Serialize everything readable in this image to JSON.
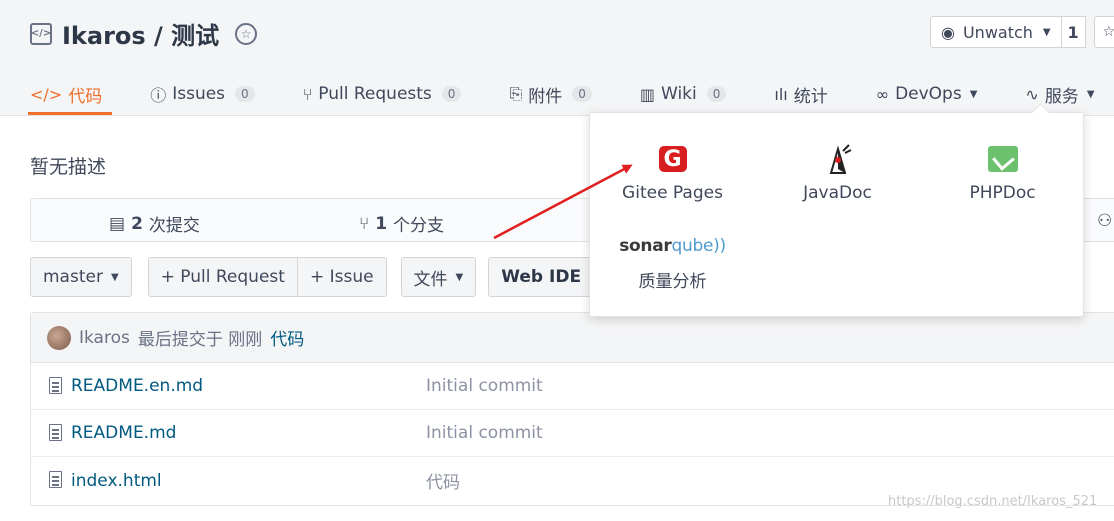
{
  "repo": {
    "title": "Ikaros / 测试"
  },
  "watch": {
    "label": "Unwatch",
    "count": "1"
  },
  "tabs": [
    {
      "label": "代码",
      "count": ""
    },
    {
      "label": "Issues",
      "count": "0"
    },
    {
      "label": "Pull Requests",
      "count": "0"
    },
    {
      "label": "附件",
      "count": "0"
    },
    {
      "label": "Wiki",
      "count": "0"
    },
    {
      "label": "统计",
      "count": ""
    },
    {
      "label": "DevOps",
      "count": ""
    },
    {
      "label": "服务",
      "count": ""
    }
  ],
  "description": "暂无描述",
  "stats": {
    "commits_count": "2",
    "commits_label": "次提交",
    "branches_count": "1",
    "branches_label": "个分支"
  },
  "toolbar": {
    "branch": "master",
    "pull_request": "+ Pull Request",
    "issue": "+ Issue",
    "file": "文件",
    "web_ide": "Web IDE"
  },
  "commit": {
    "author": "Ikaros",
    "text": "最后提交于 刚刚",
    "message": "代码"
  },
  "files": [
    {
      "name": "README.en.md",
      "message": "Initial commit"
    },
    {
      "name": "README.md",
      "message": "Initial commit"
    },
    {
      "name": "index.html",
      "message": "代码"
    }
  ],
  "menu": {
    "items": [
      {
        "label": "Gitee Pages",
        "logo": "G"
      },
      {
        "label": "JavaDoc"
      },
      {
        "label": "PHPDoc"
      },
      {
        "label": "质量分析",
        "logo": "sonarqube"
      }
    ],
    "sonar_a": "sonar",
    "sonar_b": "qube"
  },
  "watermark": "https://blog.csdn.net/Ikaros_521",
  "colors": {
    "accent": "#f06f2d",
    "link": "#005980",
    "arrow": "#e02020"
  }
}
